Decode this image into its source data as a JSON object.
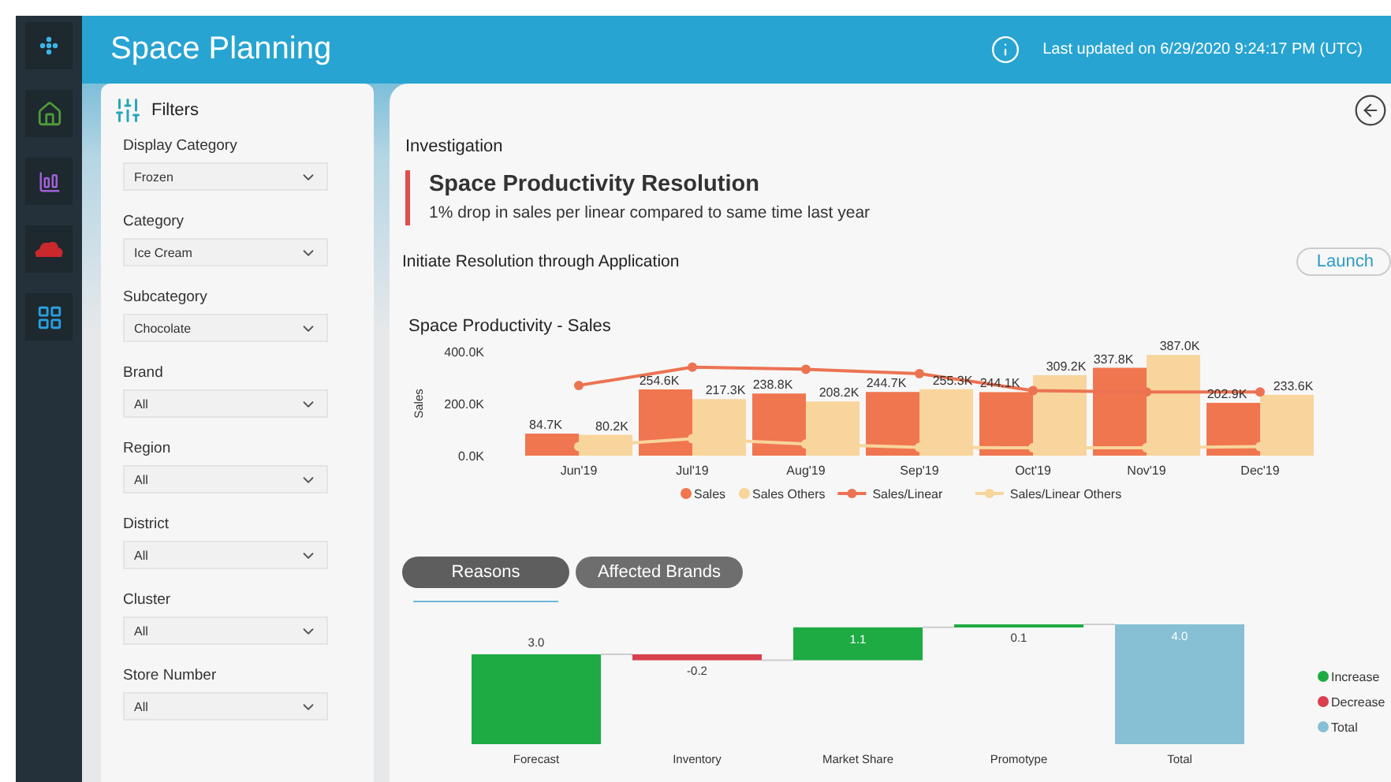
{
  "app": {
    "title": "Space Planning",
    "last_updated": "Last updated on 6/29/2020 9:24:17 PM (UTC)"
  },
  "filters": {
    "title": "Filters",
    "fields": [
      {
        "label": "Display Category",
        "value": "Frozen"
      },
      {
        "label": "Category",
        "value": "Ice Cream"
      },
      {
        "label": "Subcategory",
        "value": "Chocolate"
      },
      {
        "label": "Brand",
        "value": "All"
      },
      {
        "label": "Region",
        "value": "All"
      },
      {
        "label": "District",
        "value": "All"
      },
      {
        "label": "Cluster",
        "value": "All"
      },
      {
        "label": "Store Number",
        "value": "All"
      }
    ]
  },
  "investigation": {
    "heading": "Investigation",
    "title": "Space Productivity Resolution",
    "description": "1% drop in sales per linear compared to same time last year",
    "action_label": "Initiate Resolution through Application",
    "action_button": "Launch"
  },
  "sales_chart": {
    "chart_data": {
      "type": "bar",
      "stacked": false,
      "legend": "bottom",
      "title": "Space Productivity - Sales",
      "ylabel": "Sales",
      "categories": [
        "Jun'19",
        "Jul'19",
        "Aug'19",
        "Sep'19",
        "Oct'19",
        "Nov'19",
        "Dec'19"
      ],
      "ylim": [
        0,
        400000
      ],
      "yticks": [
        {
          "value": 0,
          "label": "0.0K"
        },
        {
          "value": 200000,
          "label": "200.0K"
        },
        {
          "value": 400000,
          "label": "400.0K"
        }
      ],
      "series": [
        {
          "name": "Sales",
          "type": "bar",
          "color": "#f07650",
          "values": [
            84700,
            254600,
            238800,
            244700,
            244100,
            337800,
            202900
          ],
          "value_labels": [
            "84.7K",
            "254.6K",
            "238.8K",
            "244.7K",
            "244.1K",
            "337.8K",
            "202.9K"
          ]
        },
        {
          "name": "Sales Others",
          "type": "bar",
          "color": "#f8d59c",
          "values": [
            80200,
            217300,
            208200,
            255300,
            309200,
            387000,
            233600
          ],
          "value_labels": [
            "80.2K",
            "217.3K",
            "208.2K",
            "255.3K",
            "309.2K",
            "387.0K",
            "233.6K"
          ]
        },
        {
          "name": "Sales/Linear",
          "type": "line",
          "marker": "circle",
          "color": "#ec7352",
          "values": [
            270000,
            340000,
            332000,
            315000,
            250000,
            245000,
            245000
          ]
        },
        {
          "name": "Sales/Linear Others",
          "type": "line",
          "marker": "circle",
          "color": "#f8d59c",
          "values": [
            35000,
            65000,
            45000,
            32000,
            30000,
            30000,
            35000
          ]
        }
      ]
    }
  },
  "tabs": [
    {
      "label": "Reasons",
      "selected": true
    },
    {
      "label": "Affected Brands",
      "selected": false
    }
  ],
  "reasons_chart": {
    "bars": [
      {
        "label": "Forecast",
        "value": "3.0",
        "kind": "increase"
      },
      {
        "label": "Inventory",
        "value": "-0.2",
        "kind": "decrease"
      },
      {
        "label": "Market Share",
        "value": "1.1",
        "kind": "increase"
      },
      {
        "label": "Promotype",
        "value": "0.1",
        "kind": "increase"
      },
      {
        "label": "Total",
        "value": "4.0",
        "kind": "total"
      }
    ],
    "legend": [
      {
        "label": "Increase",
        "color": "#1fab43"
      },
      {
        "label": "Decrease",
        "color": "#d8404f"
      },
      {
        "label": "Total",
        "color": "#87bfd4"
      }
    ]
  }
}
